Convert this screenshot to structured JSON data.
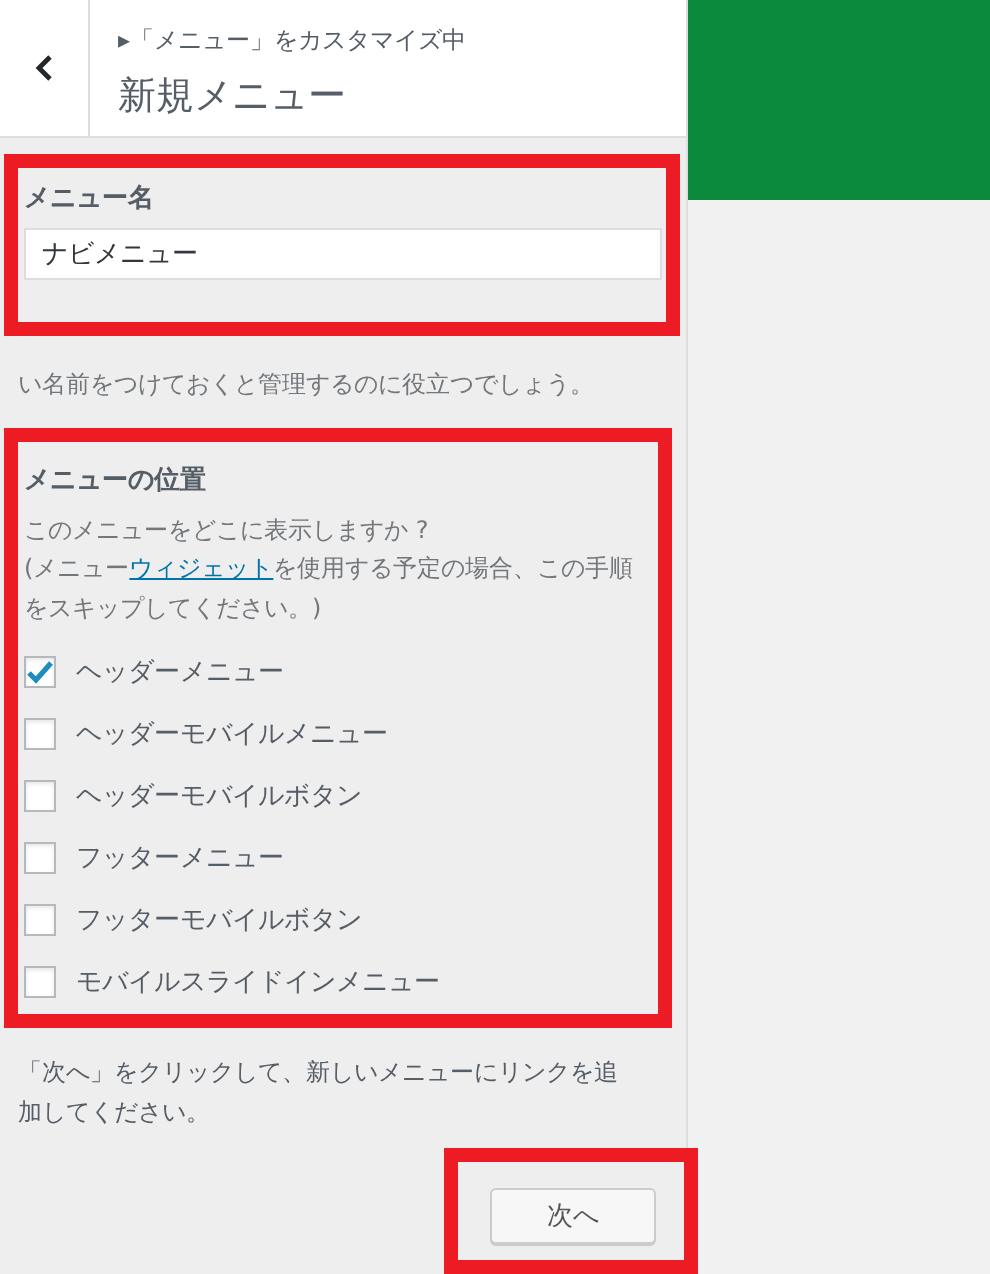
{
  "header": {
    "breadcrumb": "▸「メニュー」をカスタマイズ中",
    "title": "新規メニュー"
  },
  "menu_name": {
    "label": "メニュー名",
    "value": "ナビメニュー",
    "description": "い名前をつけておくと管理するのに役立つでしょう。"
  },
  "location": {
    "label": "メニューの位置",
    "question": "このメニューをどこに表示しますか ?",
    "note_before": "(メニュー",
    "note_link": "ウィジェット",
    "note_after": "を使用する予定の場合、この手順をスキップしてください。)",
    "options": [
      {
        "label": "ヘッダーメニュー",
        "checked": true
      },
      {
        "label": "ヘッダーモバイルメニュー",
        "checked": false
      },
      {
        "label": "ヘッダーモバイルボタン",
        "checked": false
      },
      {
        "label": "フッターメニュー",
        "checked": false
      },
      {
        "label": "フッターモバイルボタン",
        "checked": false
      },
      {
        "label": "モバイルスライドインメニュー",
        "checked": false
      }
    ]
  },
  "footer_text": "「次へ」をクリックして、新しいメニューにリンクを追加してください。",
  "next_button": "次へ"
}
